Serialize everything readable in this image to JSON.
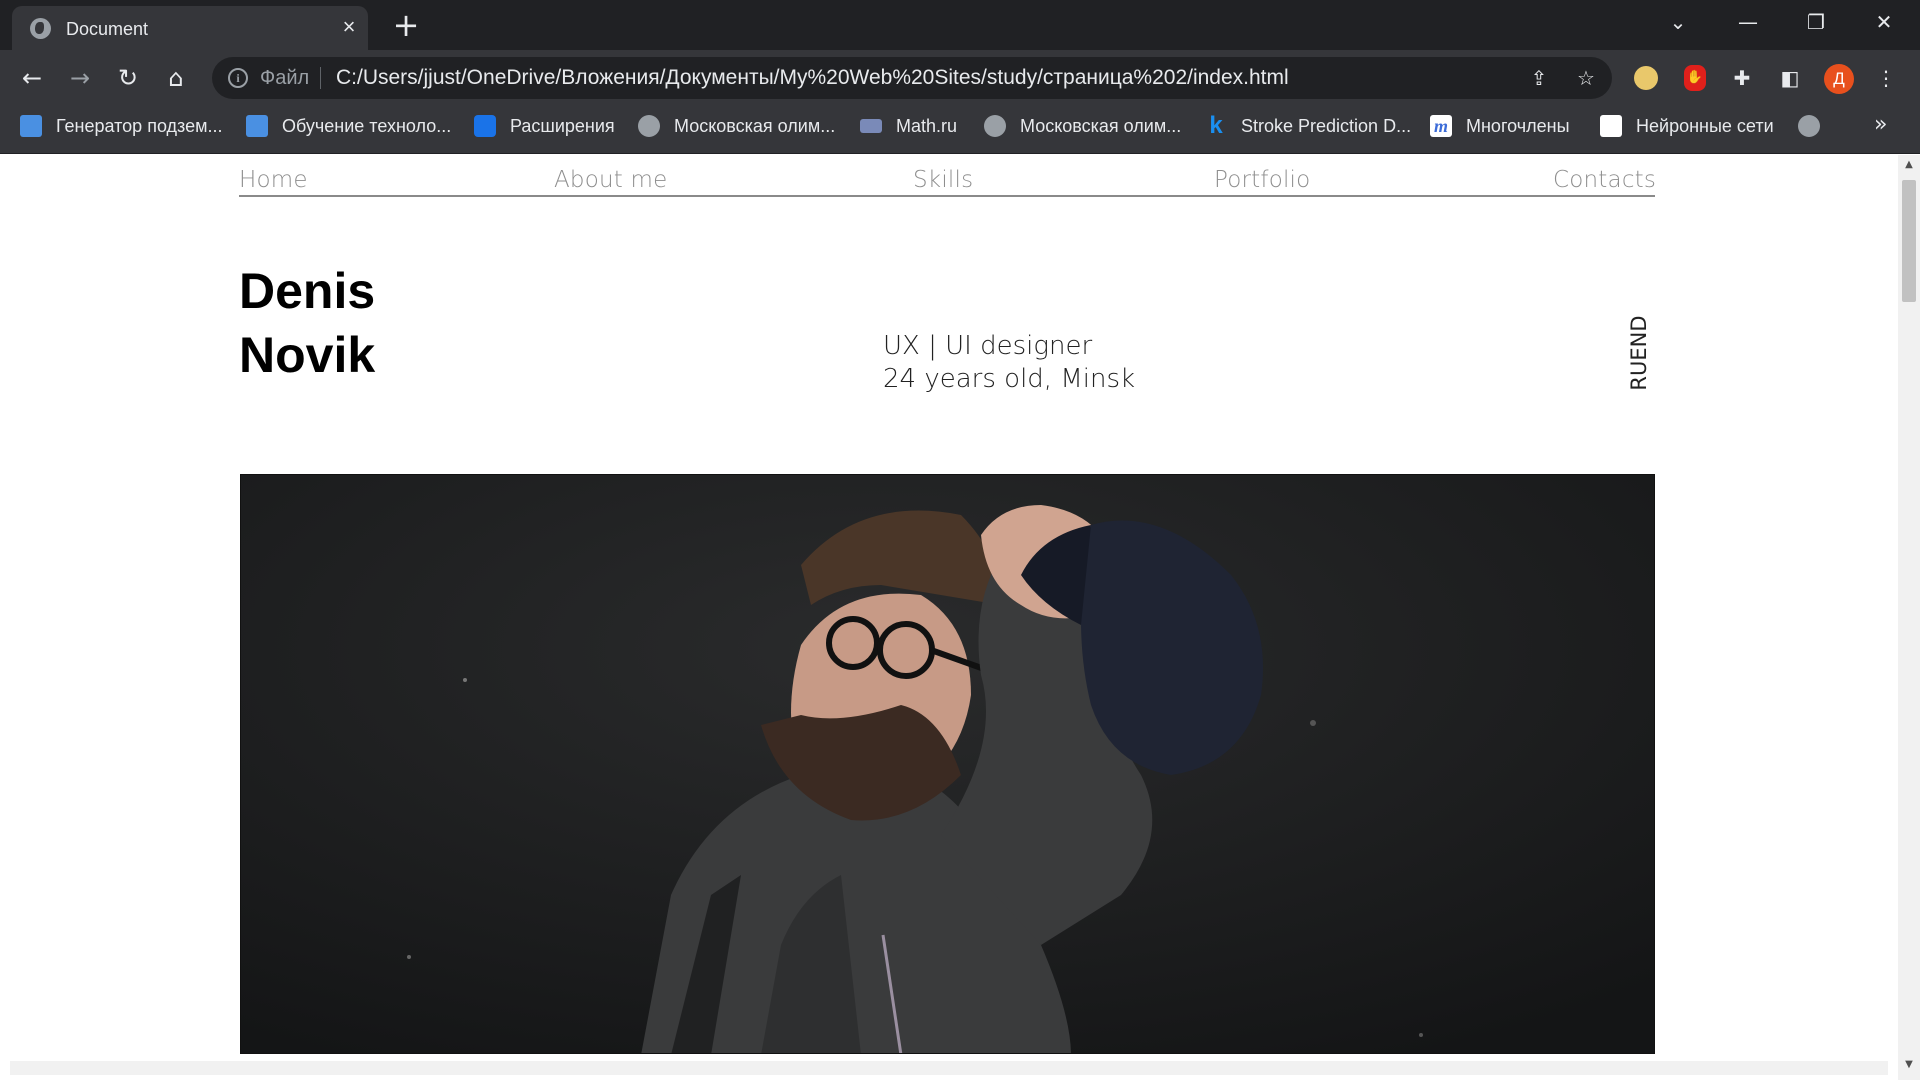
{
  "browser": {
    "tab_title": "Document",
    "file_label": "Файл",
    "url": "C:/Users/jjust/OneDrive/Вложения/Документы/My%20Web%20Sites/study/страница%202/index.html",
    "profile_initial": "Д"
  },
  "bookmarks": [
    {
      "label": "Генератор подзем...",
      "icon": "snowflake-icon"
    },
    {
      "label": "Обучение техноло...",
      "icon": "snowflake-icon"
    },
    {
      "label": "Расширения",
      "icon": "puzzle-icon"
    },
    {
      "label": "Московская олим...",
      "icon": "globe-icon"
    },
    {
      "label": "Math.ru",
      "icon": "math-icon"
    },
    {
      "label": "Московская олим...",
      "icon": "globe-icon"
    },
    {
      "label": "Stroke Prediction D...",
      "icon": "kaggle-icon"
    },
    {
      "label": "Многочлены",
      "icon": "m-icon"
    },
    {
      "label": "Нейронные сети",
      "icon": "neural-icon"
    }
  ],
  "site": {
    "nav": [
      "Home",
      "About me",
      "Skills",
      "Portfolio",
      "Contacts"
    ],
    "name_first": "Denis",
    "name_last": "Novik",
    "role": "UX | UI designer",
    "bio": "24 years old, Minsk",
    "lang": [
      "RU",
      "EN",
      "D"
    ]
  },
  "colors": {
    "chrome_dark": "#202124",
    "chrome": "#35363a",
    "nav_text": "#8e8e8e",
    "profile": "#e8501d"
  }
}
